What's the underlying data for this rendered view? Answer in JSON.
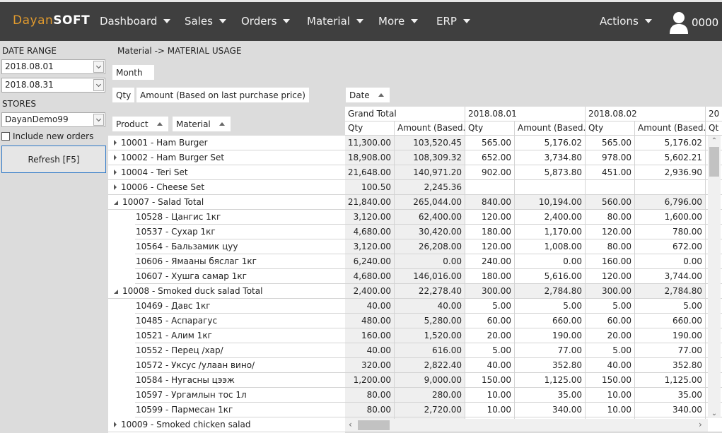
{
  "app": {
    "logo_part1": "Dayan",
    "logo_part2": "SOFT",
    "brand_color": "#e09a2e",
    "nav": [
      "Dashboard",
      "Sales",
      "Orders",
      "Material",
      "More",
      "ERP"
    ],
    "actions_label": "Actions",
    "user_label": "0000"
  },
  "sidebar": {
    "date_range_label": "DATE RANGE",
    "date_from": "2018.08.01",
    "date_to": "2018.08.31",
    "stores_label": "STORES",
    "store": "DayanDemo99",
    "include_new_orders_label": "Include new orders",
    "include_new_orders_checked": false,
    "refresh_label": "Refresh [F5]"
  },
  "breadcrumb": "Material -> MATERIAL USAGE",
  "pivot": {
    "filter_field": "Month",
    "data_fields": [
      "Qty",
      "Amount (Based on last purchase price)"
    ],
    "column_field": "Date",
    "row_fields": [
      "Product",
      "Material"
    ],
    "column_groups": [
      "Grand Total",
      "2018.08.01",
      "2018.08.02",
      "20"
    ],
    "subheaders": [
      "Qty",
      "Amount (Based...",
      "Qty",
      "Amount (Based...",
      "Qty",
      "Amount (Based...",
      "Qt"
    ],
    "rows": [
      {
        "label": "10001 - Ham Burger",
        "level": 0,
        "state": "collapsed",
        "values": [
          "11,300.00",
          "103,520.45",
          "565.00",
          "5,176.02",
          "565.00",
          "5,176.02"
        ]
      },
      {
        "label": "10002 - Ham Burger Set",
        "level": 0,
        "state": "collapsed",
        "values": [
          "18,908.00",
          "108,309.32",
          "652.00",
          "3,734.80",
          "978.00",
          "5,602.21"
        ]
      },
      {
        "label": "10004 - Teri Set",
        "level": 0,
        "state": "collapsed",
        "values": [
          "21,648.00",
          "140,971.20",
          "902.00",
          "5,873.80",
          "451.00",
          "2,936.90"
        ]
      },
      {
        "label": "10006 - Cheese Set",
        "level": 0,
        "state": "collapsed",
        "values": [
          "100.50",
          "2,245.36",
          "",
          "",
          "",
          ""
        ]
      },
      {
        "label": "10007 - Salad Total",
        "level": 0,
        "state": "expanded",
        "values": [
          "21,840.00",
          "265,044.00",
          "840.00",
          "10,194.00",
          "560.00",
          "6,796.00"
        ]
      },
      {
        "label": "10528 - Цангис 1кг",
        "level": 1,
        "state": "",
        "values": [
          "3,120.00",
          "62,400.00",
          "120.00",
          "2,400.00",
          "80.00",
          "1,600.00"
        ]
      },
      {
        "label": "10537 - Сухар 1кг",
        "level": 1,
        "state": "",
        "values": [
          "4,680.00",
          "30,420.00",
          "180.00",
          "1,170.00",
          "120.00",
          "780.00"
        ]
      },
      {
        "label": "10564 - Бальзамик цуу",
        "level": 1,
        "state": "",
        "values": [
          "3,120.00",
          "26,208.00",
          "120.00",
          "1,008.00",
          "80.00",
          "672.00"
        ]
      },
      {
        "label": "10606 - Ямааны бяслаг 1кг",
        "level": 1,
        "state": "",
        "values": [
          "6,240.00",
          "0.00",
          "240.00",
          "0.00",
          "160.00",
          "0.00"
        ]
      },
      {
        "label": "10607 - Хушга самар 1кг",
        "level": 1,
        "state": "",
        "values": [
          "4,680.00",
          "146,016.00",
          "180.00",
          "5,616.00",
          "120.00",
          "3,744.00"
        ]
      },
      {
        "label": "10008 - Smoked duck salad Total",
        "level": 0,
        "state": "expanded",
        "values": [
          "2,400.00",
          "22,278.40",
          "300.00",
          "2,784.80",
          "300.00",
          "2,784.80"
        ]
      },
      {
        "label": "10469 - Давс 1кг",
        "level": 1,
        "state": "",
        "values": [
          "40.00",
          "40.00",
          "5.00",
          "5.00",
          "5.00",
          "5.00"
        ]
      },
      {
        "label": "10485 - Аспарагус",
        "level": 1,
        "state": "",
        "values": [
          "480.00",
          "5,280.00",
          "60.00",
          "660.00",
          "60.00",
          "660.00"
        ]
      },
      {
        "label": "10521 - Алим 1кг",
        "level": 1,
        "state": "",
        "values": [
          "160.00",
          "1,520.00",
          "20.00",
          "190.00",
          "20.00",
          "190.00"
        ]
      },
      {
        "label": "10552 - Перец /хар/",
        "level": 1,
        "state": "",
        "values": [
          "40.00",
          "616.00",
          "5.00",
          "77.00",
          "5.00",
          "77.00"
        ]
      },
      {
        "label": "10572 - Уксус /улаан вино/",
        "level": 1,
        "state": "",
        "values": [
          "320.00",
          "2,822.40",
          "40.00",
          "352.80",
          "40.00",
          "352.80"
        ]
      },
      {
        "label": "10584 - Нугасны цээж",
        "level": 1,
        "state": "",
        "values": [
          "1,200.00",
          "9,000.00",
          "150.00",
          "1,125.00",
          "150.00",
          "1,125.00"
        ]
      },
      {
        "label": "10597 - Ургамлын тос 1л",
        "level": 1,
        "state": "",
        "values": [
          "80.00",
          "280.00",
          "10.00",
          "35.00",
          "10.00",
          "35.00"
        ]
      },
      {
        "label": "10599 - Пармесан 1кг",
        "level": 1,
        "state": "",
        "values": [
          "80.00",
          "2,720.00",
          "10.00",
          "340.00",
          "10.00",
          "340.00"
        ]
      },
      {
        "label": "10009 - Smoked chicken salad",
        "level": 0,
        "state": "collapsed",
        "values": [
          "",
          "",
          "",
          "",
          "",
          ""
        ]
      }
    ]
  }
}
